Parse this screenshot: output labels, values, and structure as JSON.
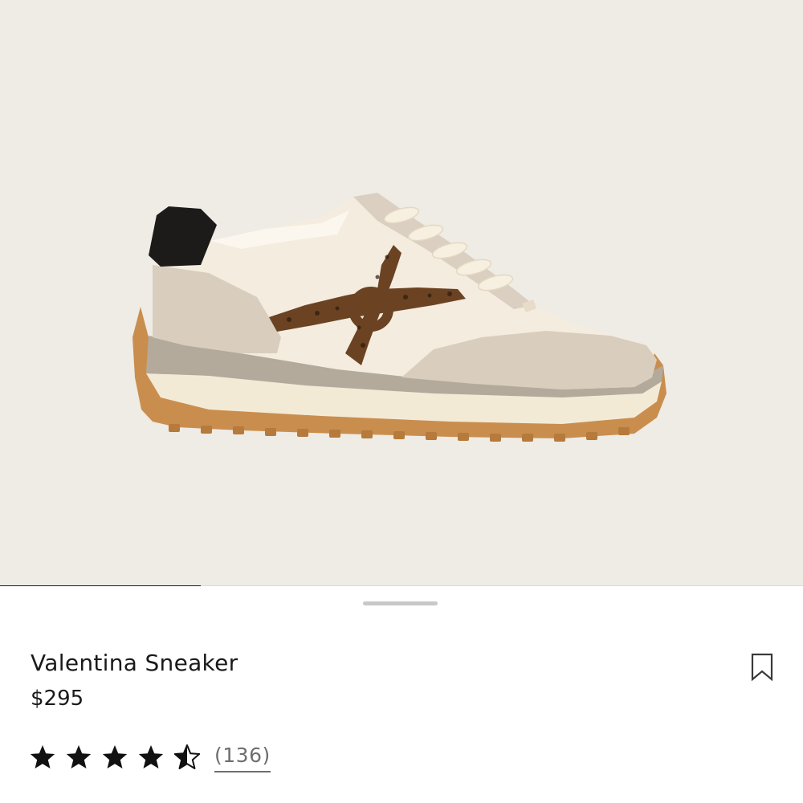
{
  "product": {
    "name": "Valentina Sneaker",
    "price": "$295",
    "image_alt": "Valentina Sneaker product image",
    "rating": {
      "value": 4.5,
      "max": 5,
      "review_count_label": "(136)"
    },
    "bookmark_icon": "bookmark-outline-icon"
  },
  "gallery": {
    "progress_fraction": 0.25
  },
  "colors": {
    "gallery_bg": "#efebe5",
    "text": "#1a1a1a",
    "muted": "#6e6e6e",
    "accent": "#1a1a1a"
  }
}
